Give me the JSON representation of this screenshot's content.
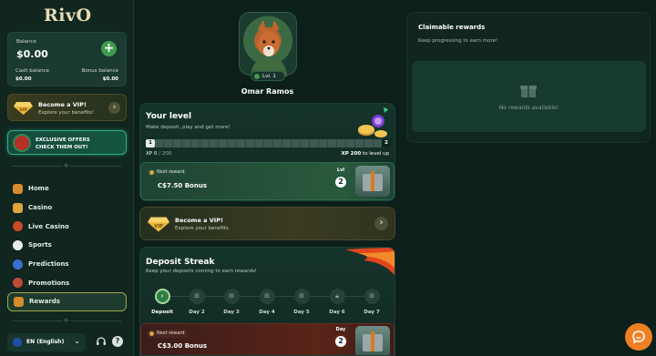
{
  "brand": {
    "logo": "RivO"
  },
  "balance": {
    "label": "Balance",
    "value": "$0.00",
    "add_icon": "plus-icon",
    "cash_label": "Cash balance",
    "cash_value": "$0.00",
    "bonus_label": "Bonus balance",
    "bonus_value": "$0.00"
  },
  "vip_card": {
    "title": "Become a VIP!",
    "subtitle": "Explore your benefits!",
    "badge": "VIP"
  },
  "offers_card": {
    "line1": "EXCLUSIVE OFFERS",
    "line2": "CHECK THEM OUT!"
  },
  "nav": {
    "items": [
      {
        "label": "Home",
        "icon": "home-icon",
        "color": "#d98a2b"
      },
      {
        "label": "Casino",
        "icon": "casino-icon",
        "color": "#e0a63a"
      },
      {
        "label": "Live Casino",
        "icon": "live-casino-icon",
        "color": "#c94a2a"
      },
      {
        "label": "Sports",
        "icon": "sports-icon",
        "color": "#e9ecea"
      },
      {
        "label": "Predictions",
        "icon": "predictions-icon",
        "color": "#3a6fd1"
      },
      {
        "label": "Promotions",
        "icon": "promotions-icon",
        "color": "#c24a38"
      },
      {
        "label": "Rewards",
        "icon": "rewards-icon",
        "color": "#d98a2b"
      }
    ],
    "active_index": 6
  },
  "footer": {
    "language": "EN (English)",
    "support_icon": "headset-icon",
    "help_icon": "help-icon"
  },
  "profile": {
    "username": "Omar Ramos",
    "level": "Lvl. 1"
  },
  "your_level": {
    "title": "Your level",
    "subtitle": "Make deposit, play and get more!",
    "progress_start": "1",
    "progress_end": "2",
    "progress": 0.0,
    "xp_label": "XP",
    "xp_current": "0",
    "xp_total": "/ 200",
    "xp_needed": "XP 200",
    "xp_suffix": "to level up",
    "next_reward_label": "Next reward",
    "next_reward_amount": "C$7.50 Bonus",
    "reward_level_caption": "Lvl",
    "reward_level_number": "2"
  },
  "vip_banner": {
    "title": "Become a VIP!",
    "subtitle": "Explore your benefits",
    "badge": "VIP"
  },
  "deposit_streak": {
    "title": "Deposit Streak",
    "subtitle": "Keep your deposits coming to earn rewards!",
    "days": [
      {
        "label": "Deposit",
        "icon": "chevron-right-icon",
        "active": true
      },
      {
        "label": "Day 2",
        "icon": "gift-icon",
        "active": false
      },
      {
        "label": "Day 3",
        "icon": "gift-icon",
        "active": false
      },
      {
        "label": "Day 4",
        "icon": "gift-icon",
        "active": false
      },
      {
        "label": "Day 5",
        "icon": "gift-icon",
        "active": false
      },
      {
        "label": "Day 6",
        "icon": "lock-icon",
        "active": false
      },
      {
        "label": "Day 7",
        "icon": "gift-icon",
        "active": false
      }
    ],
    "next_reward_label": "Next reward",
    "next_reward_amount": "C$3.00 Bonus",
    "reward_day_caption": "Day",
    "reward_day_number": "2"
  },
  "claimable": {
    "title": "Claimable rewards",
    "subtitle": "Keep progressing to earn more!",
    "empty_text": "No rewards available!",
    "empty_icon": "gift-icon"
  },
  "colors": {
    "accent_green": "#3f9b4d",
    "chat_orange": "#ee7f23",
    "background": "#0c1f1b"
  }
}
